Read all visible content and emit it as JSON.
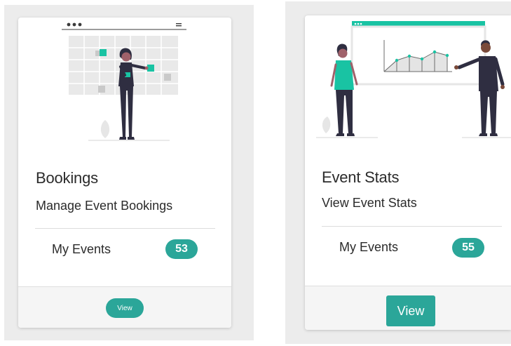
{
  "colors": {
    "accent": "#2ba699",
    "accent_bright": "#19c3a3",
    "text": "#2b2b2b",
    "panel_bg": "#ececec"
  },
  "cards": [
    {
      "title": "Bookings",
      "subtitle": "Manage Event Bookings",
      "stat_label": "My Events",
      "stat_count": "53",
      "button_label": "View",
      "illustration": "person-with-calendar-illustration"
    },
    {
      "title": "Event Stats",
      "subtitle": "View Event Stats",
      "stat_label": "My Events",
      "stat_count": "55",
      "button_label": "View",
      "illustration": "people-presenting-chart-illustration"
    }
  ]
}
